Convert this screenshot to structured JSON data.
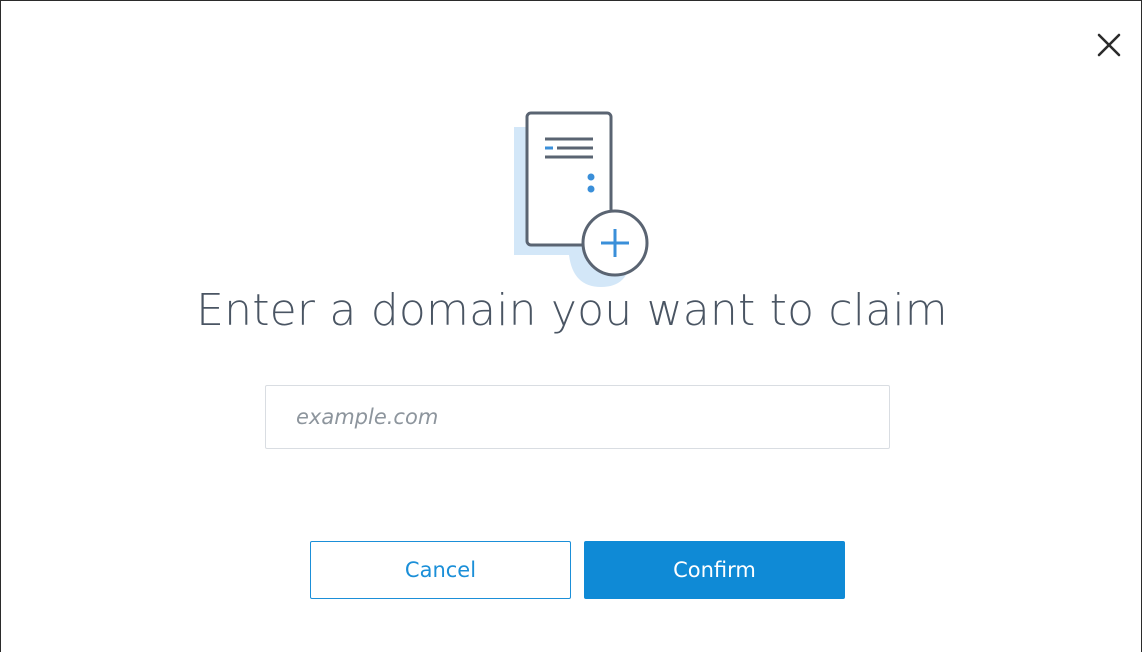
{
  "dialog": {
    "title": "Enter a domain you want to claim",
    "domain_input": {
      "value": "",
      "placeholder": "example.com"
    },
    "cancel_label": "Cancel",
    "confirm_label": "Confirm",
    "close_icon": "close-icon",
    "illustration_icon": "document-add-icon"
  },
  "colors": {
    "primary": "#0f8ad6",
    "title_text": "#4a5563",
    "illustration_accent": "#3a8fd9",
    "illustration_backdrop": "#d3e7f8"
  }
}
